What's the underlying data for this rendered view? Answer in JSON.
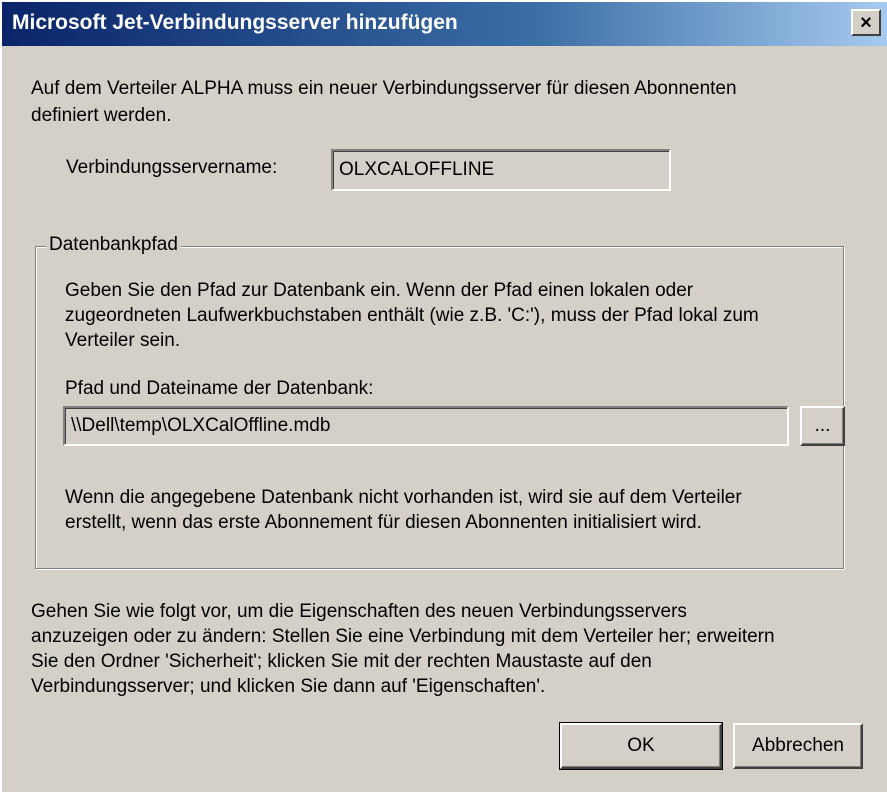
{
  "window": {
    "title": "Microsoft Jet-Verbindungsserver hinzufügen",
    "close_glyph": "×"
  },
  "intro": {
    "line1": "Auf dem Verteiler ALPHA muss ein neuer Verbindungsserver für diesen Abonnenten",
    "line2": "definiert werden."
  },
  "server_name": {
    "label": "Verbindungsservername:",
    "value": "OLXCALOFFLINE"
  },
  "database_group": {
    "label": "Datenbankpfad",
    "desc_line1": "Geben Sie den Pfad zur Datenbank ein. Wenn der Pfad einen lokalen oder",
    "desc_line2": "zugeordneten Laufwerkbuchstaben enthält (wie z.B. 'C:'), muss der Pfad lokal zum",
    "desc_line3": "Verteiler sein.",
    "path_label": "Pfad und Dateiname der Datenbank:",
    "path_value": "\\\\Dell\\temp\\OLXCalOffline.mdb",
    "browse_label": "...",
    "note_line1": "Wenn die angegebene Datenbank nicht vorhanden ist, wird sie auf dem Verteiler",
    "note_line2": "erstellt, wenn das erste Abonnement für diesen Abonnenten initialisiert wird."
  },
  "footer": {
    "line1": "Gehen Sie wie folgt vor, um die Eigenschaften des neuen Verbindungsservers",
    "line2": "anzuzeigen oder zu ändern: Stellen Sie eine Verbindung mit dem Verteiler her; erweitern",
    "line3": "Sie den Ordner 'Sicherheit'; klicken Sie mit der rechten Maustaste auf den",
    "line4": "Verbindungsserver; und klicken Sie dann auf 'Eigenschaften'."
  },
  "buttons": {
    "ok": "OK",
    "cancel": "Abbrechen"
  },
  "colors": {
    "titlebar_start": "#0a246a",
    "titlebar_end": "#a6caf0",
    "face": "#d4d0c8"
  },
  "icons": {
    "close": "close-icon"
  }
}
